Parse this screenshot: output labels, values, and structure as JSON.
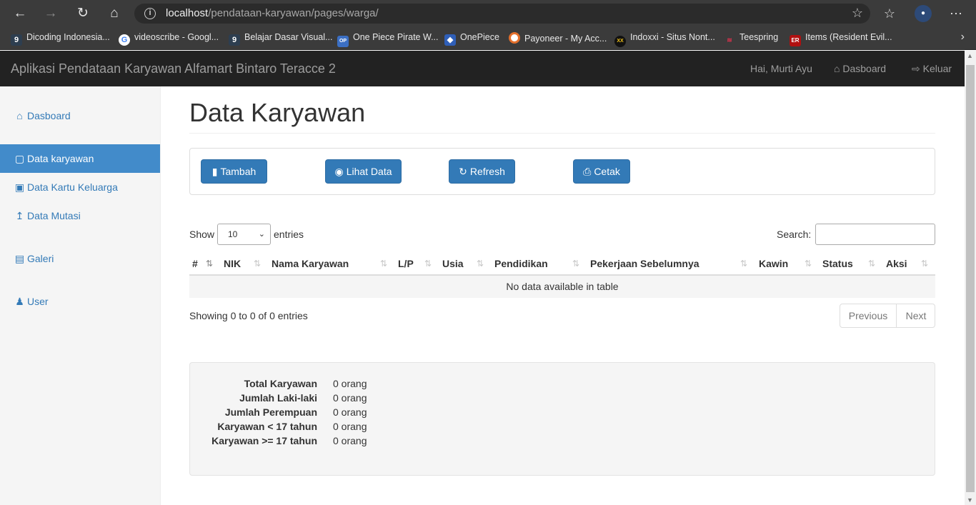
{
  "browser": {
    "url_host": "localhost",
    "url_path": "/pendataan-karyawan/pages/warga/",
    "bookmarks": [
      {
        "label": "Dicoding Indonesia...",
        "icon": "dicoding-icon",
        "color": "#2d3e50"
      },
      {
        "label": "videoscribe - Googl...",
        "icon": "google-icon",
        "color": "#4285f4"
      },
      {
        "label": "Belajar Dasar Visual...",
        "icon": "dicoding-icon",
        "color": "#2d3e50"
      },
      {
        "label": "One Piece Pirate W...",
        "icon": "onepiece-icon",
        "color": "#3b6fc4"
      },
      {
        "label": "OnePiece",
        "icon": "shield-icon",
        "color": "#2f5fb8"
      },
      {
        "label": "Payoneer - My Acc...",
        "icon": "payoneer-icon",
        "color": "#e36f2c"
      },
      {
        "label": "Indoxxi - Situs Nont...",
        "icon": "indoxxi-icon",
        "color": "#111111"
      },
      {
        "label": "Teespring",
        "icon": "teespring-icon",
        "color": "#d6324c"
      },
      {
        "label": "Items (Resident Evil...",
        "icon": "re-icon",
        "color": "#b01010"
      }
    ]
  },
  "navbar": {
    "brand": "Aplikasi Pendataan Karyawan Alfamart Bintaro Teracce 2",
    "greeting": "Hai, Murti Ayu",
    "dashboard": "Dasboard",
    "logout": "Keluar"
  },
  "sidebar": {
    "items": [
      {
        "label": "Dasboard",
        "icon": "home-icon",
        "active": false
      },
      {
        "label": "Data karyawan",
        "icon": "book-icon",
        "active": true
      },
      {
        "label": "Data Kartu Keluarga",
        "icon": "inbox-icon",
        "active": false
      },
      {
        "label": "Data Mutasi",
        "icon": "export-icon",
        "active": false
      },
      {
        "label": "Galeri",
        "icon": "picture-icon",
        "active": false
      },
      {
        "label": "User",
        "icon": "user-icon",
        "active": false
      }
    ]
  },
  "page": {
    "title": "Data Karyawan"
  },
  "toolbar": {
    "tambah": "Tambah",
    "lihat": "Lihat Data",
    "refresh": "Refresh",
    "cetak": "Cetak"
  },
  "table": {
    "show_label": "Show",
    "length_value": "10",
    "entries_label": "entries",
    "search_label": "Search:",
    "search_value": "",
    "columns": [
      "#",
      "NIK",
      "Nama Karyawan",
      "L/P",
      "Usia",
      "Pendidikan",
      "Pekerjaan Sebelumnya",
      "Kawin",
      "Status",
      "Aksi"
    ],
    "empty_message": "No data available in table",
    "info": "Showing 0 to 0 of 0 entries",
    "previous": "Previous",
    "next": "Next"
  },
  "summary": {
    "rows": [
      {
        "label": "Total Karyawan",
        "value": "0 orang"
      },
      {
        "label": "Jumlah Laki-laki",
        "value": "0 orang"
      },
      {
        "label": "Jumlah Perempuan",
        "value": "0 orang"
      },
      {
        "label": "Karyawan < 17 tahun",
        "value": "0 orang"
      },
      {
        "label": "Karyawan >= 17 tahun",
        "value": "0 orang"
      }
    ]
  },
  "colors": {
    "primary": "#337ab7",
    "active_sidebar": "#428bca",
    "navbar": "#222222"
  }
}
